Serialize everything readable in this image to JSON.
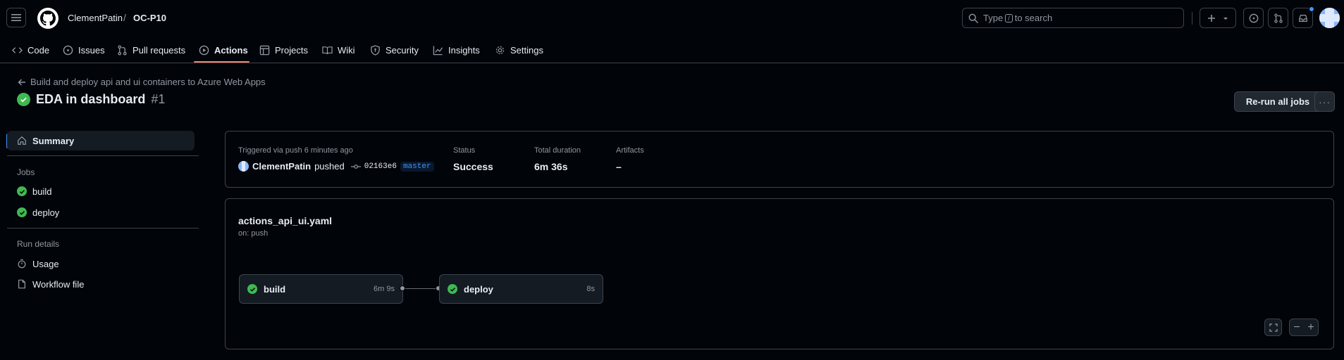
{
  "header": {
    "owner": "ClementPatin",
    "separator": "/",
    "repo": "OC-P10",
    "search_prefix": "Type",
    "search_kbd": "/",
    "search_suffix": "to search"
  },
  "repo_nav": {
    "items": [
      {
        "label": "Code",
        "icon": "code-icon"
      },
      {
        "label": "Issues",
        "icon": "issue-icon"
      },
      {
        "label": "Pull requests",
        "icon": "pull-request-icon"
      },
      {
        "label": "Actions",
        "icon": "play-icon",
        "active": true
      },
      {
        "label": "Projects",
        "icon": "table-icon"
      },
      {
        "label": "Wiki",
        "icon": "book-icon"
      },
      {
        "label": "Security",
        "icon": "shield-icon"
      },
      {
        "label": "Insights",
        "icon": "graph-icon"
      },
      {
        "label": "Settings",
        "icon": "gear-icon"
      }
    ]
  },
  "run": {
    "back_label": "Build and deploy api and ui containers to Azure Web Apps",
    "title": "EDA in dashboard",
    "number": "#1",
    "rerun_label": "Re-run all jobs",
    "more_label": "···"
  },
  "sidebar": {
    "summary_label": "Summary",
    "jobs_heading": "Jobs",
    "jobs": [
      {
        "label": "build",
        "status": "success"
      },
      {
        "label": "deploy",
        "status": "success"
      }
    ],
    "run_details_heading": "Run details",
    "details": [
      {
        "label": "Usage",
        "icon": "stopwatch-icon"
      },
      {
        "label": "Workflow file",
        "icon": "file-icon"
      }
    ]
  },
  "summary": {
    "trigger_label": "Triggered via push 6 minutes ago",
    "actor": "ClementPatin",
    "action": "pushed",
    "commit": "02163e6",
    "branch": "master",
    "status_label": "Status",
    "status_value": "Success",
    "duration_label": "Total duration",
    "duration_value": "6m 36s",
    "artifacts_label": "Artifacts",
    "artifacts_value": "–"
  },
  "workflow": {
    "file": "actions_api_ui.yaml",
    "on": "on: push",
    "jobs": [
      {
        "name": "build",
        "duration": "6m 9s",
        "status": "success"
      },
      {
        "name": "deploy",
        "duration": "8s",
        "status": "success"
      }
    ],
    "zoom_out": "−",
    "zoom_in": "+"
  },
  "colors": {
    "success": "#3fb950",
    "accent": "#4493f8",
    "nav_underline": "#f78166",
    "background": "#010409"
  }
}
